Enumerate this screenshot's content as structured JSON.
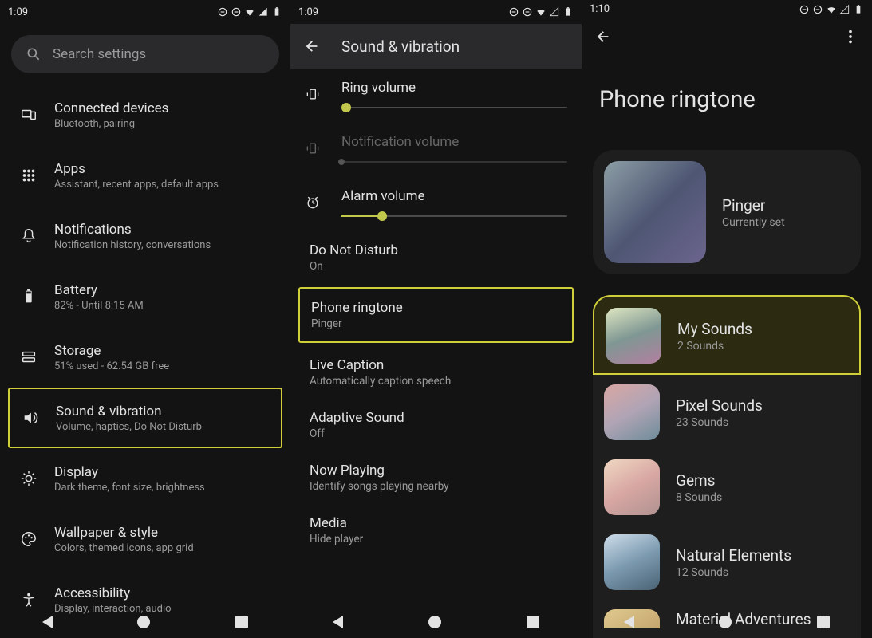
{
  "status": {
    "time1": "1:09",
    "time2": "1:09",
    "time3": "1:10"
  },
  "screen1": {
    "search_placeholder": "Search settings",
    "items": [
      {
        "title": "Connected devices",
        "sub": "Bluetooth, pairing"
      },
      {
        "title": "Apps",
        "sub": "Assistant, recent apps, default apps"
      },
      {
        "title": "Notifications",
        "sub": "Notification history, conversations"
      },
      {
        "title": "Battery",
        "sub": "82% - Until 8:15 AM"
      },
      {
        "title": "Storage",
        "sub": "51% used - 62.54 GB free"
      },
      {
        "title": "Sound & vibration",
        "sub": "Volume, haptics, Do Not Disturb"
      },
      {
        "title": "Display",
        "sub": "Dark theme, font size, brightness"
      },
      {
        "title": "Wallpaper & style",
        "sub": "Colors, themed icons, app grid"
      },
      {
        "title": "Accessibility",
        "sub": "Display, interaction, audio"
      }
    ]
  },
  "screen2": {
    "header": "Sound & vibration",
    "sliders": [
      {
        "label": "Ring volume",
        "value": 2
      },
      {
        "label": "Notification volume",
        "value": 0,
        "disabled": true
      },
      {
        "label": "Alarm volume",
        "value": 18
      }
    ],
    "rows": [
      {
        "title": "Do Not Disturb",
        "sub": "On"
      },
      {
        "title": "Phone ringtone",
        "sub": "Pinger",
        "hl": true
      },
      {
        "title": "Live Caption",
        "sub": "Automatically caption speech"
      },
      {
        "title": "Adaptive Sound",
        "sub": "Off"
      },
      {
        "title": "Now Playing",
        "sub": "Identify songs playing nearby"
      },
      {
        "title": "Media",
        "sub": "Hide player"
      }
    ]
  },
  "screen3": {
    "title": "Phone ringtone",
    "current": {
      "title": "Pinger",
      "sub": "Currently set"
    },
    "groups": [
      {
        "title": "My Sounds",
        "sub": "2 Sounds",
        "hl": true
      },
      {
        "title": "Pixel Sounds",
        "sub": "23 Sounds"
      },
      {
        "title": "Gems",
        "sub": "8 Sounds"
      },
      {
        "title": "Natural Elements",
        "sub": "12 Sounds"
      },
      {
        "title": "Material Adventures",
        "sub": ""
      }
    ]
  },
  "colors": {
    "accent": "#c2c84b",
    "highlight_border": "#cfcf3a"
  }
}
